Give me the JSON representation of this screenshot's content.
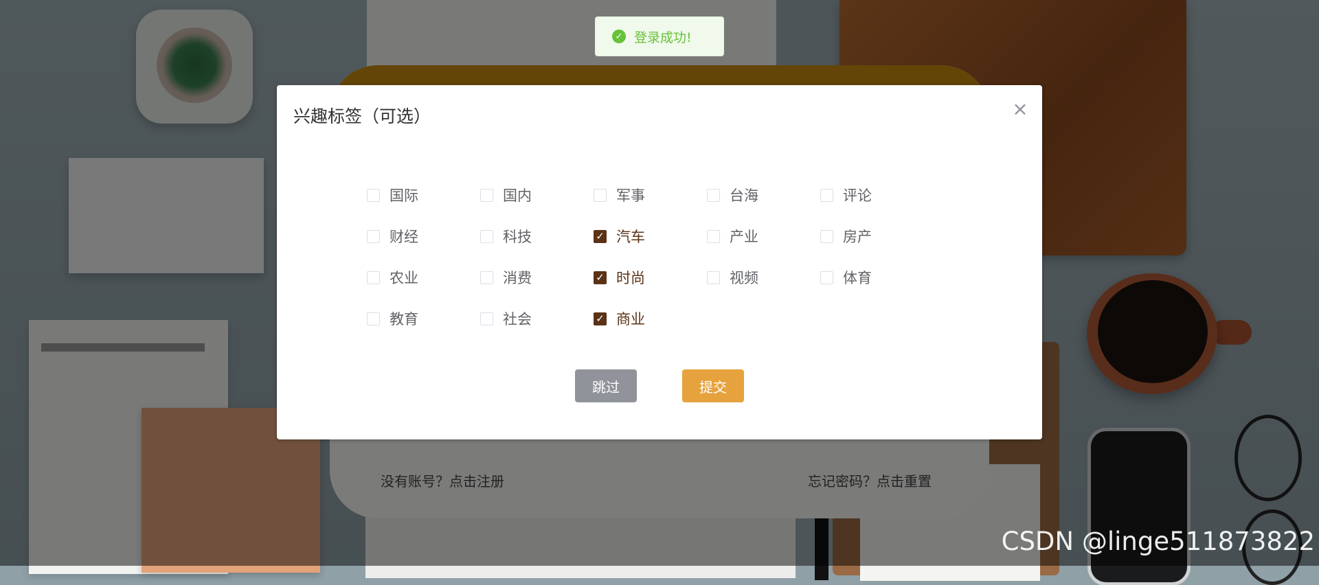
{
  "toast": {
    "text": "登录成功!",
    "icon": "check-circle-icon"
  },
  "dialog": {
    "title": "兴趣标签（可选）",
    "close_icon": "close-icon",
    "tags": [
      {
        "label": "国际",
        "checked": false
      },
      {
        "label": "国内",
        "checked": false
      },
      {
        "label": "军事",
        "checked": false
      },
      {
        "label": "台海",
        "checked": false
      },
      {
        "label": "评论",
        "checked": false
      },
      {
        "label": "财经",
        "checked": false
      },
      {
        "label": "科技",
        "checked": false
      },
      {
        "label": "汽车",
        "checked": true
      },
      {
        "label": "产业",
        "checked": false
      },
      {
        "label": "房产",
        "checked": false
      },
      {
        "label": "农业",
        "checked": false
      },
      {
        "label": "消费",
        "checked": false
      },
      {
        "label": "时尚",
        "checked": true
      },
      {
        "label": "视频",
        "checked": false
      },
      {
        "label": "体育",
        "checked": false
      },
      {
        "label": "教育",
        "checked": false
      },
      {
        "label": "社会",
        "checked": false
      },
      {
        "label": "商业",
        "checked": true
      }
    ],
    "skip_label": "跳过",
    "submit_label": "提交"
  },
  "login": {
    "register_link": "没有账号？点击注册",
    "reset_link": "忘记密码？点击重置"
  },
  "watermark": "CSDN @linge511873822",
  "colors": {
    "accent": "#e6a23c",
    "checked": "#5a3216",
    "success": "#67c23a",
    "skip": "#909399"
  }
}
